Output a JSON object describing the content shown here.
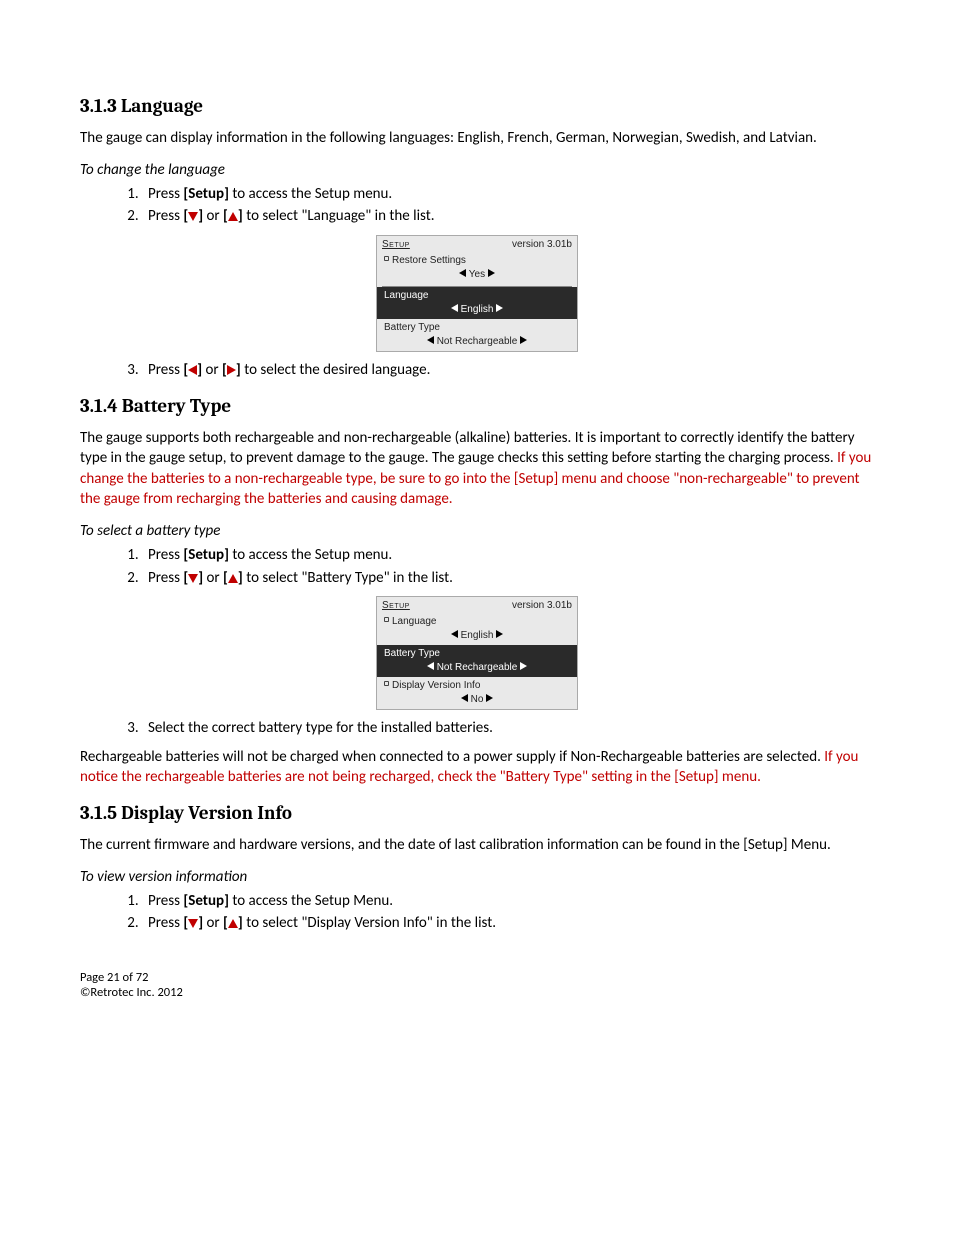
{
  "sec313": {
    "heading": "3.1.3  Language",
    "intro": "The gauge can display information in the following languages:  English, French, German, Norwegian, Swedish, and Latvian.",
    "instr_head": "To change the language",
    "step1_a": "Press ",
    "step1_b": "[Setup]",
    "step1_c": " to access the Setup menu.",
    "step2_a": "Press ",
    "step2_b": " or ",
    "step2_c": " to select \"Language\" in the list.",
    "step3_a": "Press ",
    "step3_b": " or ",
    "step3_c": " to select the desired language."
  },
  "screen1": {
    "setup": "Setup",
    "version": "version 3.01b",
    "r1_label": "Restore Settings",
    "r1_value": "Yes",
    "r2_label": "Language",
    "r2_value": "English",
    "r3_label": "Battery Type",
    "r3_value": "Not Rechargeable"
  },
  "sec314": {
    "heading": "3.1.4  Battery Type",
    "intro_a": "The gauge supports both rechargeable and non-rechargeable (alkaline) batteries.  It is important to correctly identify the battery type in the gauge setup, to prevent damage to the gauge.  The gauge checks this setting before starting the charging process.  ",
    "intro_b": "If you change the batteries to a non-rechargeable type, be sure to go into the [Setup] menu and choose \"non-rechargeable\" to prevent the gauge from recharging the batteries and causing damage.",
    "instr_head": "To select a battery type",
    "step1_a": "Press ",
    "step1_b": "[Setup]",
    "step1_c": " to access the Setup menu.",
    "step2_a": "Press ",
    "step2_b": " or ",
    "step2_c": " to select \"Battery Type\" in the list.",
    "step3": "Select the correct battery type for the installed batteries.",
    "after_a": "Rechargeable batteries will not be charged when connected to a power supply if Non-Rechargeable batteries are selected.  ",
    "after_b": "If you notice the rechargeable batteries are not being recharged, check the \"Battery Type\" setting in the [Setup] menu."
  },
  "screen2": {
    "setup": "Setup",
    "version": "version 3.01b",
    "r1_label": "Language",
    "r1_value": "English",
    "r2_label": "Battery Type",
    "r2_value": "Not Rechargeable",
    "r3_label": "Display Version Info",
    "r3_value": "No"
  },
  "sec315": {
    "heading": "3.1.5  Display Version Info",
    "intro": "The current firmware and hardware versions, and the date of last calibration information can be found in the [Setup] Menu.",
    "instr_head": "To view version information",
    "step1_a": "Press ",
    "step1_b": "[Setup]",
    "step1_c": " to access the Setup Menu.",
    "step2_a": "Press ",
    "step2_b": " or ",
    "step2_c": " to select \"Display Version Info\" in the list."
  },
  "footer": {
    "page": "Page 21 of 72",
    "copy": "©Retrotec Inc. 2012"
  }
}
